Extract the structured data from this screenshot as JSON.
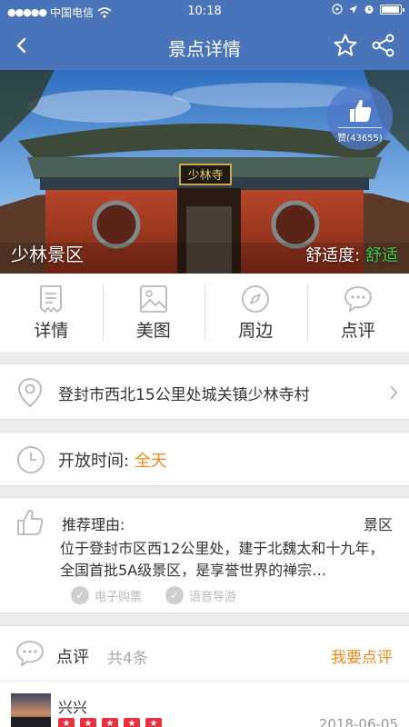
{
  "status_bar": {
    "signal": "●●●●●",
    "carrier": "中国电信",
    "time": "10:18"
  },
  "nav": {
    "title": "景点详情"
  },
  "hero": {
    "name": "少林景区",
    "comfort_label": "舒适度:",
    "comfort_value": "舒适",
    "likes": "赞(43655)",
    "gate_plaque": "少林寺"
  },
  "tabs": [
    {
      "label": "详情",
      "icon": "document-icon"
    },
    {
      "label": "美图",
      "icon": "image-icon"
    },
    {
      "label": "周边",
      "icon": "compass-icon"
    },
    {
      "label": "点评",
      "icon": "chat-icon"
    }
  ],
  "address": {
    "text": "登封市西北15公里处城关镇少林寺村"
  },
  "hours": {
    "label": "开放时间:",
    "value": "全天"
  },
  "recommend": {
    "title": "推荐理由:",
    "type": "景区",
    "description": "位于登封市区西12公里处，建于北魏太和十九年，全国首批5A级景区，是享誉世界的禅宗…",
    "features": [
      "电子购票",
      "语音导游"
    ]
  },
  "reviews": {
    "label": "点评",
    "count": "共4条",
    "write_label": "我要点评",
    "items": [
      {
        "user": "兴兴",
        "rating": 5,
        "date": "2018-06-05"
      }
    ]
  },
  "colors": {
    "primary": "#4a74b9",
    "accent": "#f08a1c",
    "comfort": "#3cc64a",
    "star": "#e8313d"
  }
}
